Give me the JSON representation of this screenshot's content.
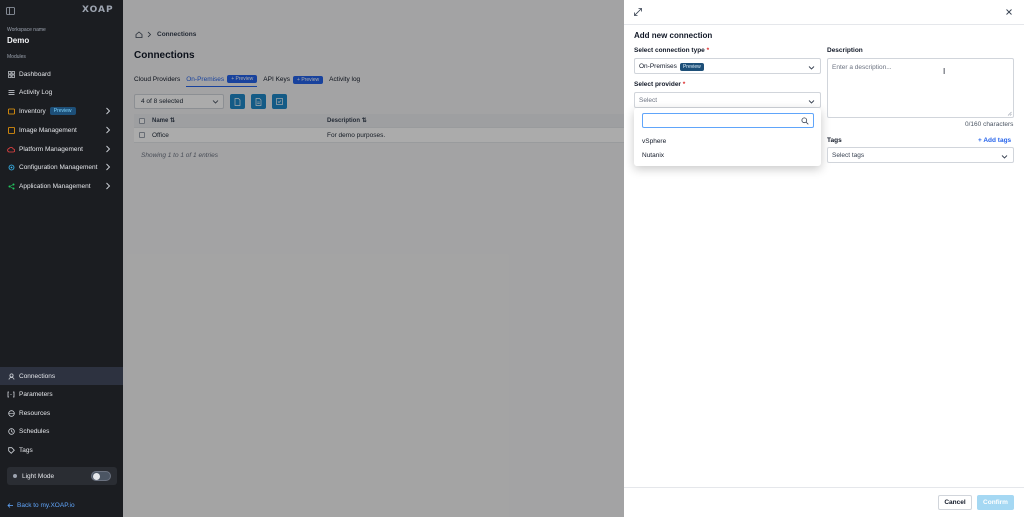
{
  "sidebar": {
    "logo": "XOAP",
    "workspace_label": "Workspace name",
    "workspace_name": "Demo",
    "modules_label": "Modules",
    "items": [
      {
        "label": "Dashboard",
        "icon": "dashboard-icon"
      },
      {
        "label": "Activity Log",
        "icon": "list-icon"
      },
      {
        "label": "Inventory",
        "icon": "inventory-icon",
        "badge": "Preview",
        "has_chevron": true
      },
      {
        "label": "Image Management",
        "icon": "image-icon",
        "has_chevron": true
      },
      {
        "label": "Platform Management",
        "icon": "cloud-icon",
        "has_chevron": true
      },
      {
        "label": "Configuration Management",
        "icon": "config-icon",
        "has_chevron": true
      },
      {
        "label": "Application Management",
        "icon": "share-icon",
        "has_chevron": true
      }
    ],
    "bottom_items": [
      {
        "label": "Connections",
        "icon": "connections-icon",
        "active": true
      },
      {
        "label": "Parameters",
        "icon": "parameters-icon"
      },
      {
        "label": "Resources",
        "icon": "resources-icon"
      },
      {
        "label": "Schedules",
        "icon": "clock-icon"
      },
      {
        "label": "Tags",
        "icon": "tag-icon"
      }
    ],
    "light_mode_label": "Light Mode",
    "back_link": "Back to my.XOAP.io"
  },
  "main": {
    "breadcrumb": "Connections",
    "title": "Connections",
    "tabs": [
      {
        "label": "Cloud Providers"
      },
      {
        "label": "On-Premises",
        "badge": "+ Preview",
        "active": true
      },
      {
        "label": "API Keys",
        "badge": "+ Preview"
      },
      {
        "label": "Activity log"
      }
    ],
    "selected_text": "4 of 8 selected",
    "table": {
      "columns": [
        "Name",
        "Description"
      ],
      "rows": [
        {
          "name": "Office",
          "description": "For demo purposes."
        }
      ]
    },
    "entries_text": "Showing 1 to 1 of 1 entries"
  },
  "drawer": {
    "title": "Add new connection",
    "connection_type_label": "Select connection type",
    "connection_type_value": "On-Premises",
    "connection_type_badge": "Preview",
    "provider_label": "Select provider",
    "provider_placeholder": "Select",
    "provider_options": [
      "vSphere",
      "Nutanix"
    ],
    "description_label": "Description",
    "description_placeholder": "Enter a description...",
    "char_count": "0/160 characters",
    "tags_label": "Tags",
    "add_tags": "+ Add tags",
    "tags_placeholder": "Select tags",
    "cancel": "Cancel",
    "confirm": "Confirm",
    "required_mark": "*"
  },
  "colors": {
    "sidebar_bg": "#1b1d21",
    "accent": "#2563eb",
    "button_blue": "#1e88c8",
    "confirm_disabled": "#a5d8f3"
  }
}
